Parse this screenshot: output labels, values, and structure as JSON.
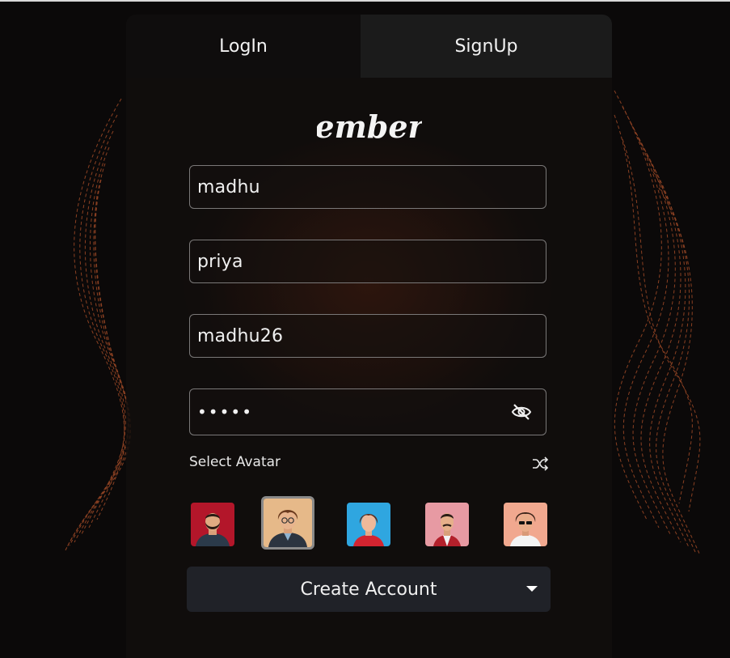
{
  "tabs": {
    "login_label": "LogIn",
    "signup_label": "SignUp"
  },
  "logo": {
    "text": "ember"
  },
  "form": {
    "first_name": "madhu",
    "last_name": "priya",
    "username": "madhu26",
    "password": "•••••"
  },
  "avatar_section": {
    "label": "Select Avatar"
  },
  "avatars": [
    "avatar-bearded-man",
    "avatar-glasses-person",
    "avatar-woman-blue",
    "avatar-man-mustache",
    "avatar-man-sunglasses"
  ],
  "selected_avatar_index": 1,
  "create_button": {
    "label": "Create Account"
  },
  "colors": {
    "accent_wave": "#b5532b",
    "button_bg": "#202228"
  }
}
